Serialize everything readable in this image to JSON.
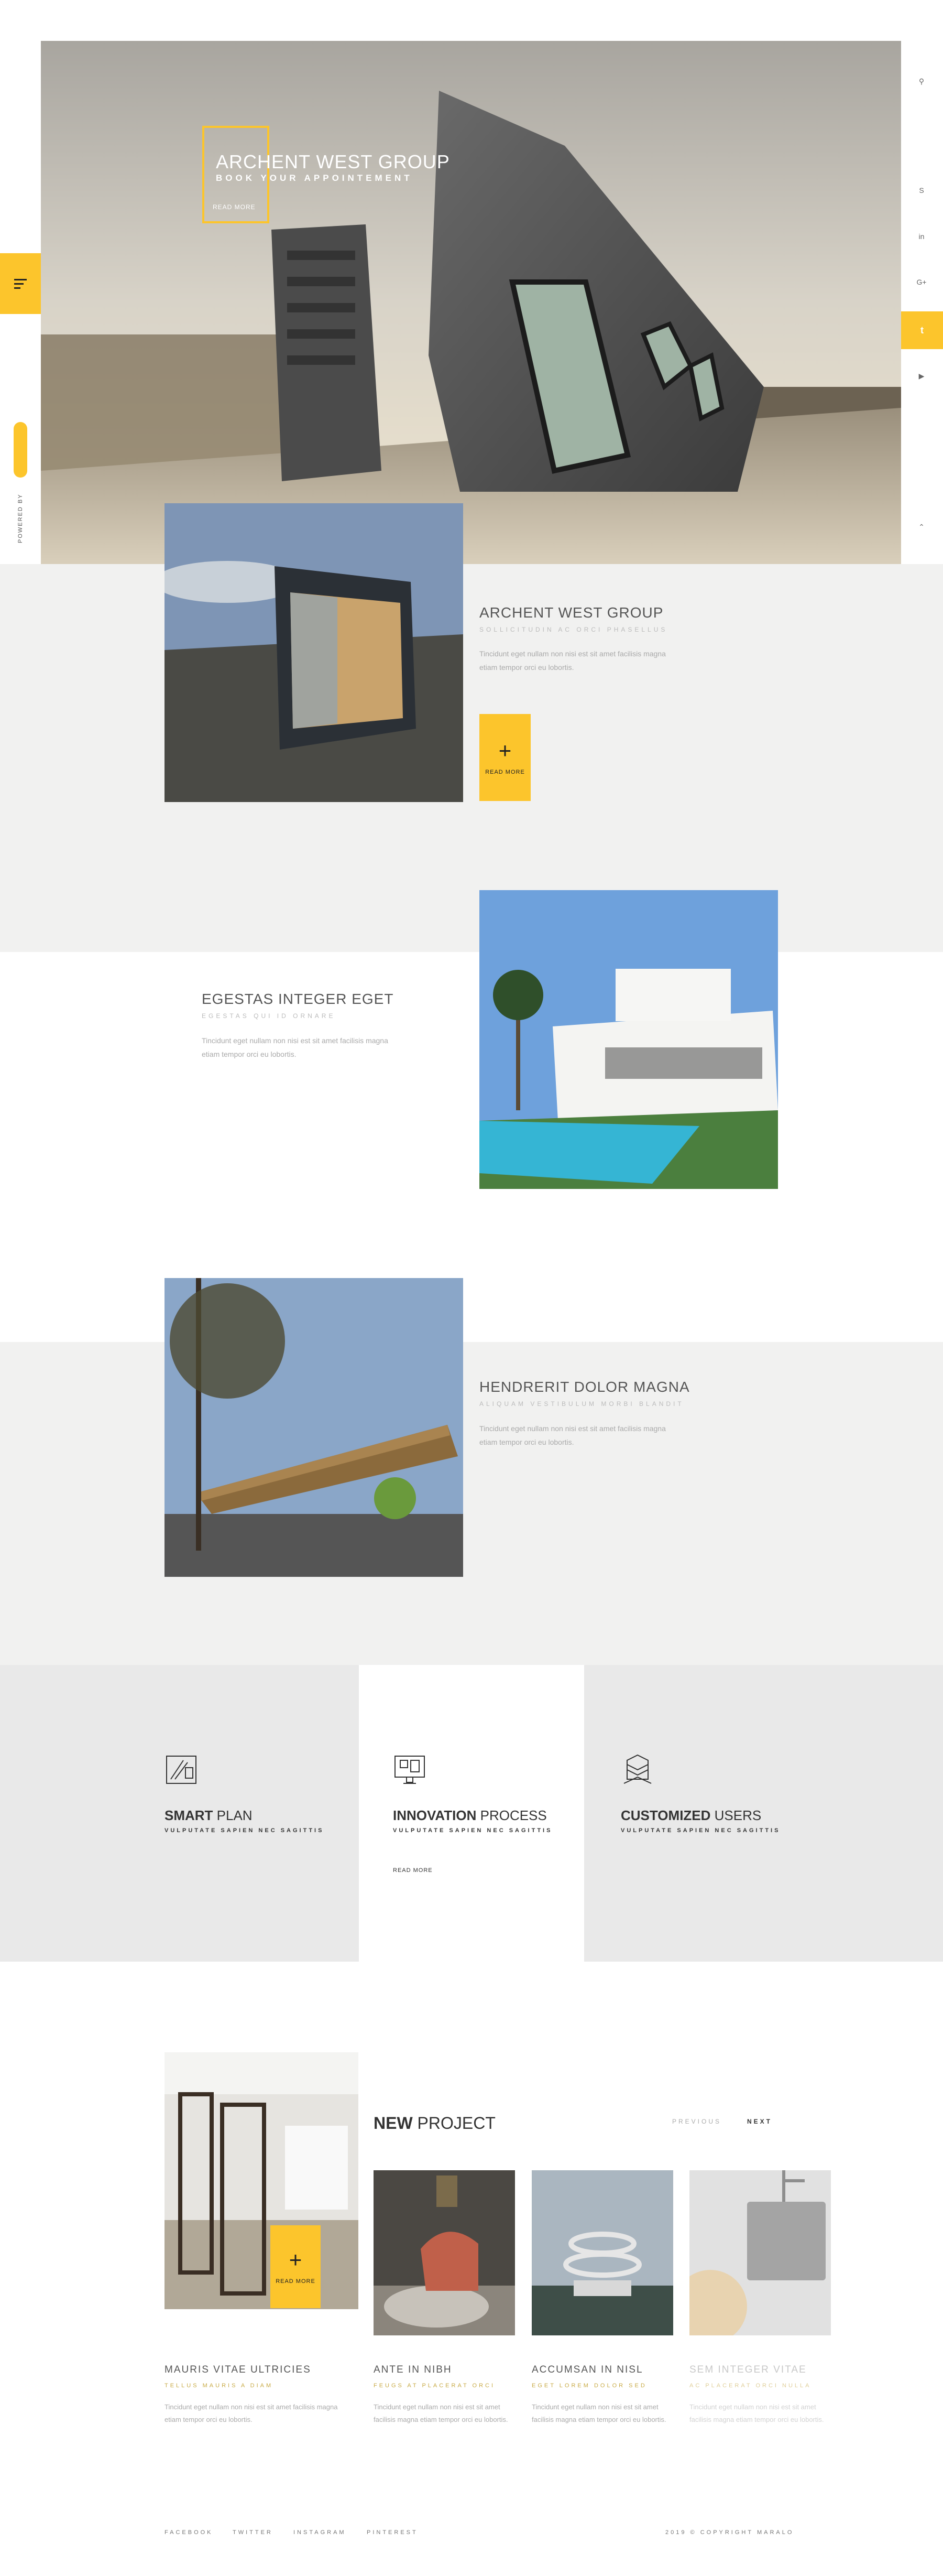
{
  "hero": {
    "title": "ARCHENT WEST GROUP",
    "subtitle": "BOOK YOUR APPOINTEMENT",
    "read_more": "READ MORE"
  },
  "left_rail": {
    "menu_icon": "hamburger-icon",
    "powered_by": "POWERED BY",
    "badge_icon": "brand-badge-icon"
  },
  "right_rail": {
    "icons": [
      "search-icon",
      "skype-icon",
      "linkedin-icon",
      "google-plus-icon",
      "twitter-icon",
      "youtube-icon",
      "chevron-up-icon"
    ]
  },
  "sections": [
    {
      "title": "ARCHENT WEST GROUP",
      "subtitle": "SOLLICITUDIN AC ORCI PHASELLUS",
      "body": "Tincidunt eget nullam non nisi est sit amet facilisis magna etiam tempor orci eu lobortis.",
      "button": "READ MORE"
    },
    {
      "title": "EGESTAS INTEGER EGET",
      "subtitle": "EGESTAS QUI ID ORNARE",
      "body": "Tincidunt eget nullam non nisi est sit amet facilisis magna etiam tempor orci eu lobortis."
    },
    {
      "title": "HENDRERIT DOLOR MAGNA",
      "subtitle": "ALIQUAM VESTIBULUM MORBI BLANDIT",
      "body": "Tincidunt eget nullam non nisi est sit amet facilisis magna etiam tempor orci eu lobortis."
    }
  ],
  "features": [
    {
      "bold": "SMART",
      "light": " PLAN",
      "sub": "VULPUTATE SAPIEN NEC SAGITTIS",
      "icon": "blueprint-icon"
    },
    {
      "bold": "INNOVATION",
      "light": " PROCESS",
      "sub": "VULPUTATE SAPIEN NEC SAGITTIS",
      "read_more": "READ MORE",
      "icon": "monitor-plan-icon"
    },
    {
      "bold": "CUSTOMIZED",
      "light": " USERS",
      "sub": "VULPUTATE SAPIEN NEC SAGITTIS",
      "icon": "building-icon"
    }
  ],
  "projects": {
    "heading_bold": "NEW",
    "heading_light": " PROJECT",
    "prev": "PREVIOUS",
    "next": "NEXT",
    "read_more": "READ MORE",
    "items": [
      {
        "title": "MAURIS VITAE ULTRICIES",
        "sub": "TELLUS MAURIS A DIAM",
        "body": "Tincidunt eget nullam non nisi est sit amet facilisis magna etiam tempor orci eu lobortis."
      },
      {
        "title": "ANTE IN NIBH",
        "sub": "FEUGS AT PLACERAT ORCI",
        "body": "Tincidunt eget nullam non nisi est sit amet facilisis magna etiam tempor orci eu lobortis."
      },
      {
        "title": "ACCUMSAN IN NISL",
        "sub": "EGET LOREM DOLOR SED",
        "body": "Tincidunt eget nullam non nisi est sit amet facilisis magna etiam tempor orci eu lobortis."
      },
      {
        "title": "SEM INTEGER VITAE",
        "sub": "AC PLACERAT ORCI NULLA",
        "body": "Tincidunt eget nullam non nisi est sit amet facilisis magna etiam tempor orci eu lobortis."
      }
    ]
  },
  "footer": {
    "links": [
      "FACEBOOK",
      "TWITTER",
      "INSTAGRAM",
      "PINTEREST"
    ],
    "copyright": "2019 © COPYRIGHT MARALO"
  },
  "colors": {
    "accent": "#fcc52c",
    "band": "#f1f1f0",
    "feature_grey": "#e9e9e9"
  }
}
